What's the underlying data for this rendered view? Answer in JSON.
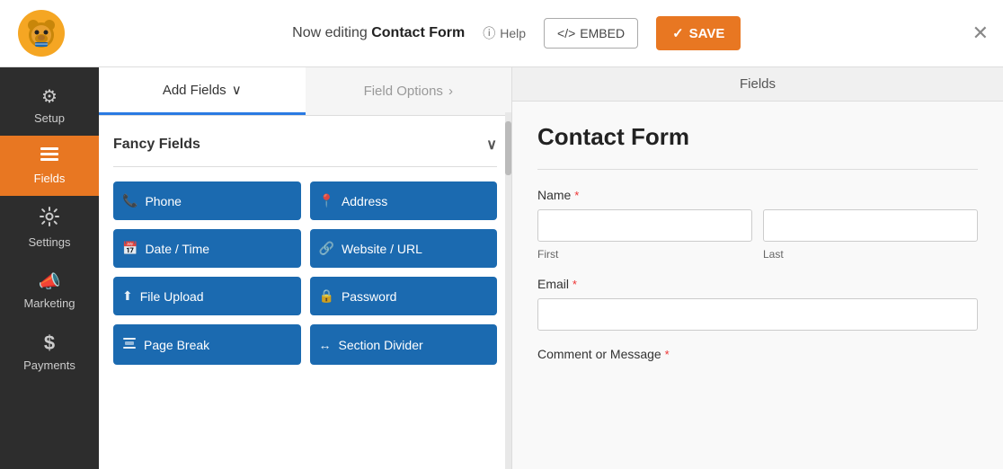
{
  "topbar": {
    "editing_prefix": "Now editing ",
    "form_name": "Contact Form",
    "help_label": "Help",
    "embed_label": "EMBED",
    "save_label": "SAVE",
    "close_label": "✕"
  },
  "sidebar": {
    "items": [
      {
        "id": "setup",
        "label": "Setup",
        "icon": "⚙️",
        "active": false
      },
      {
        "id": "fields",
        "label": "Fields",
        "icon": "☰",
        "active": true
      },
      {
        "id": "settings",
        "label": "Settings",
        "icon": "⚡",
        "active": false
      },
      {
        "id": "marketing",
        "label": "Marketing",
        "icon": "📣",
        "active": false
      },
      {
        "id": "payments",
        "label": "Payments",
        "icon": "$",
        "active": false
      }
    ]
  },
  "fields_panel": {
    "tabs": [
      {
        "id": "add_fields",
        "label": "Add Fields",
        "active": true,
        "chevron": "∨"
      },
      {
        "id": "field_options",
        "label": "Field Options",
        "active": false,
        "arrow": ">"
      }
    ],
    "fancy_fields_label": "Fancy Fields",
    "buttons": [
      {
        "id": "phone",
        "label": "Phone",
        "icon": "📞"
      },
      {
        "id": "address",
        "label": "Address",
        "icon": "📍"
      },
      {
        "id": "date_time",
        "label": "Date / Time",
        "icon": "📅"
      },
      {
        "id": "website_url",
        "label": "Website / URL",
        "icon": "🔗"
      },
      {
        "id": "file_upload",
        "label": "File Upload",
        "icon": "⬆"
      },
      {
        "id": "password",
        "label": "Password",
        "icon": "🔒"
      },
      {
        "id": "page_break",
        "label": "Page Break",
        "icon": "📄"
      },
      {
        "id": "section_divider",
        "label": "Section Divider",
        "icon": "↔"
      }
    ]
  },
  "form_preview": {
    "panel_label": "Fields",
    "form_title": "Contact Form",
    "fields": [
      {
        "id": "name",
        "label": "Name",
        "required": true,
        "type": "name",
        "sub_labels": [
          "First",
          "Last"
        ]
      },
      {
        "id": "email",
        "label": "Email",
        "required": true,
        "type": "text"
      },
      {
        "id": "comment",
        "label": "Comment or Message",
        "required": true,
        "type": "textarea"
      }
    ]
  }
}
